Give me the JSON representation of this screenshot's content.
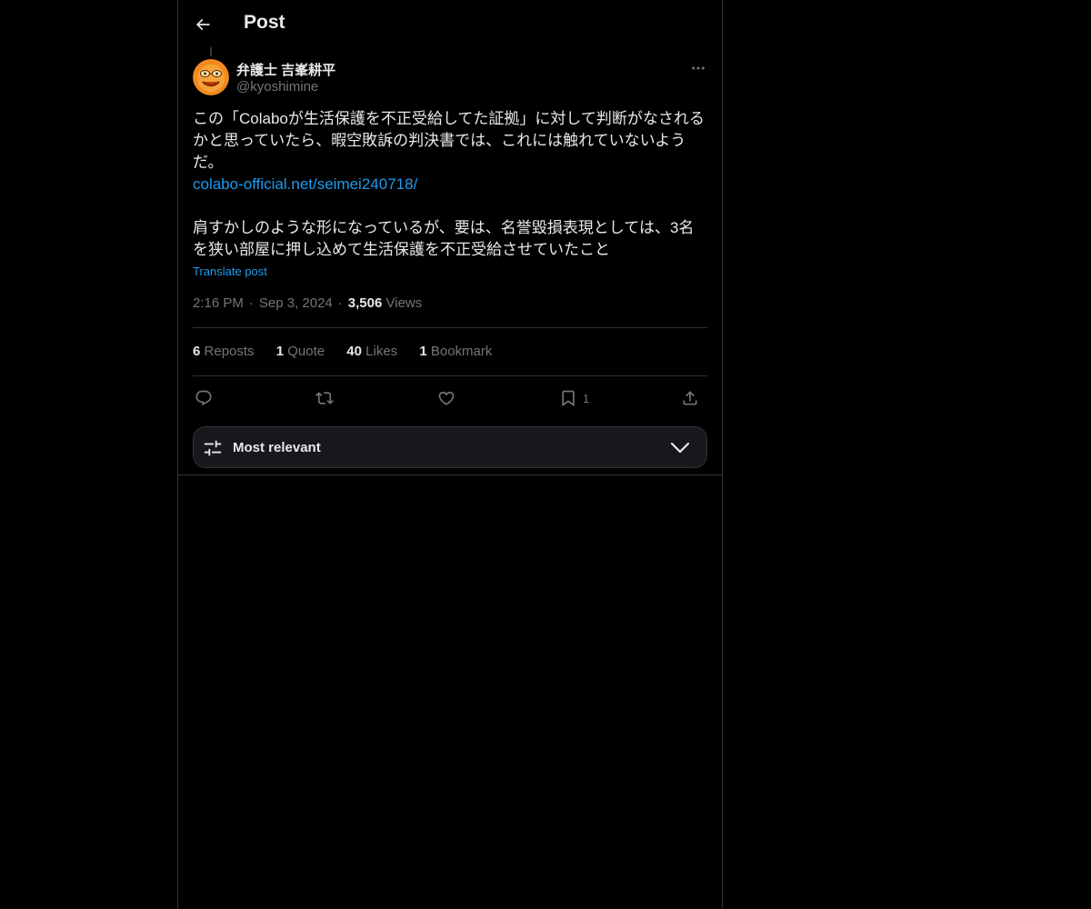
{
  "header": {
    "title": "Post",
    "back_icon": "arrow-left-icon"
  },
  "post": {
    "author": {
      "name": "弁護士 吉峯耕平",
      "handle": "@kyoshimine",
      "avatar_icon": "avatar-orange-face"
    },
    "more_icon": "ellipsis-icon",
    "text_part1": "この「Colaboが生活保護を不正受給してた証拠」に対して判断がなされるかと思っていたら、暇空敗訴の判決書では、これには触れていないようだ。",
    "link": "colabo-official.net/seimei240718/",
    "text_part2": "肩すかしのような形になっているが、要は、名誉毀損表現としては、3名を狭い部屋に押し込めて生活保護を不正受給させていたこと",
    "translate_label": "Translate post",
    "time": "2:16 PM",
    "date": "Sep 3, 2024",
    "views_count": "3,506",
    "views_label": "Views"
  },
  "stats": {
    "reposts_count": "6",
    "reposts_label": "Reposts",
    "quotes_count": "1",
    "quotes_label": "Quote",
    "likes_count": "40",
    "likes_label": "Likes",
    "bookmarks_count": "1",
    "bookmarks_label": "Bookmark"
  },
  "actions": {
    "reply_icon": "reply-icon",
    "repost_icon": "repost-icon",
    "like_icon": "heart-icon",
    "bookmark_icon": "bookmark-icon",
    "bookmark_count": "1",
    "share_icon": "share-icon"
  },
  "sort": {
    "label": "Most relevant",
    "icon": "sliders-icon"
  },
  "colors": {
    "background": "#000000",
    "text": "#e7e9ea",
    "secondary": "#71767b",
    "accent": "#1d9bf0",
    "border": "#2f3336"
  }
}
